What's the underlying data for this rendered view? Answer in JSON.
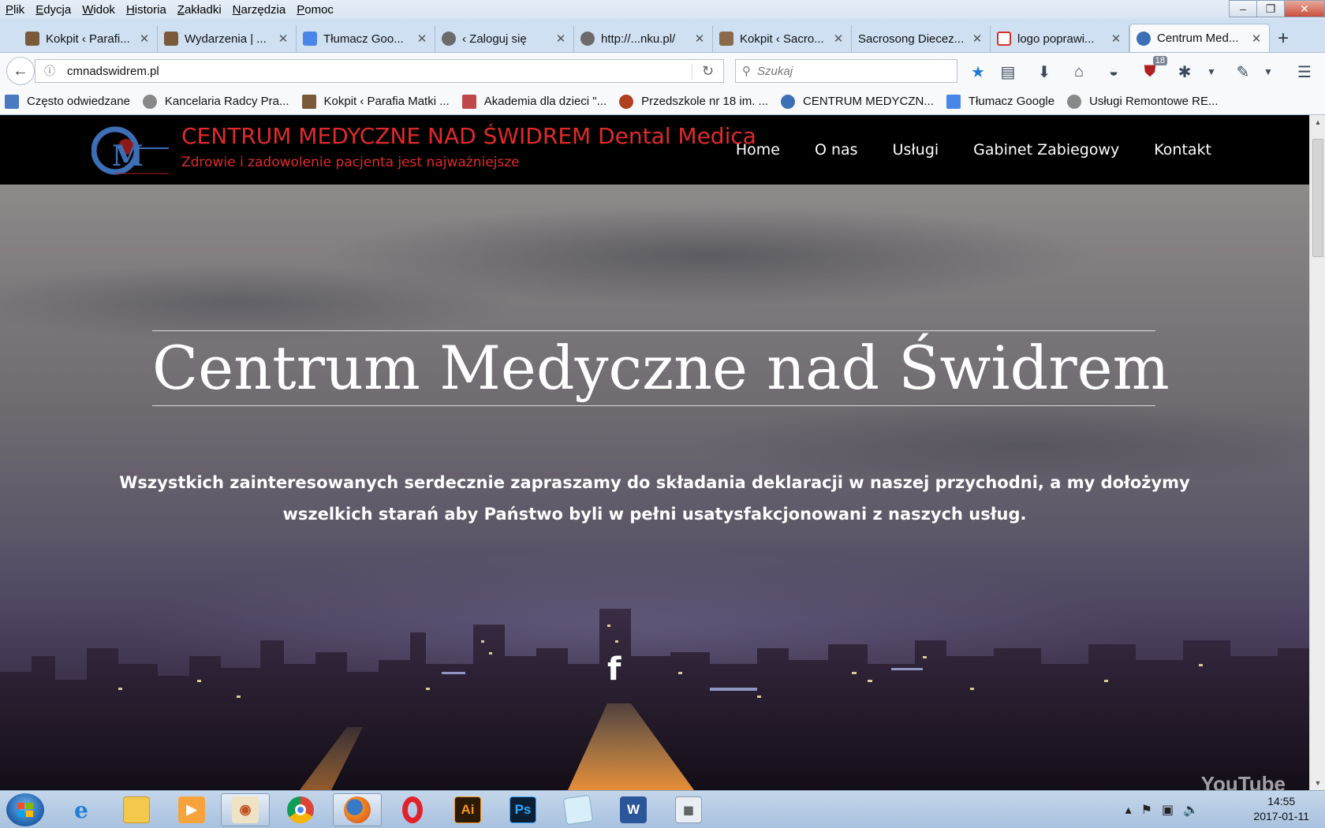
{
  "menu": [
    "Plik",
    "Edycja",
    "Widok",
    "Historia",
    "Zakładki",
    "Narzędzia",
    "Pomoc"
  ],
  "tabs": [
    {
      "label": "Kokpit ‹ Parafi...",
      "fav": "#7a5a3a"
    },
    {
      "label": "Wydarzenia | ...",
      "fav": "#7a5a3a"
    },
    {
      "label": "Tłumacz Goo...",
      "fav": "#4a86e8"
    },
    {
      "label": "‹ Zaloguj się",
      "fav": "#6b6b6b"
    },
    {
      "label": "http://...nku.pl/",
      "fav": "#6b6b6b"
    },
    {
      "label": "Kokpit ‹ Sacro...",
      "fav": "#8a6a4a"
    },
    {
      "label": "Sacrosong Diecez...",
      "fav": ""
    },
    {
      "label": "logo poprawi...",
      "fav": "#d93025"
    },
    {
      "label": "Centrum Med...",
      "fav": "#3d6fb6",
      "active": true
    }
  ],
  "address": {
    "url": "cmnadswidrem.pl"
  },
  "search": {
    "placeholder": "Szukaj"
  },
  "toolbar": {
    "badge": "18"
  },
  "bookmarks": [
    {
      "label": "Często odwiedzane",
      "fav": "#4a7bc0"
    },
    {
      "label": "Kancelaria Radcy Pra...",
      "fav": "#888"
    },
    {
      "label": "Kokpit ‹ Parafia Matki ...",
      "fav": "#7a5a3a"
    },
    {
      "label": "Akademia dla dzieci \"...",
      "fav": "#c04848"
    },
    {
      "label": "Przedszkole nr 18 im. ...",
      "fav": "#b04020"
    },
    {
      "label": "CENTRUM MEDYCZN...",
      "fav": "#3d6fb6"
    },
    {
      "label": "Tłumacz Google",
      "fav": "#4a86e8"
    },
    {
      "label": "Usługi Remontowe RE...",
      "fav": "#888"
    }
  ],
  "site": {
    "title": "CENTRUM MEDYCZNE NAD ŚWIDREM Dental Medica",
    "tagline": "Zdrowie i zadowolenie pacjenta jest najważniejsze",
    "logo_text": "CM",
    "nav": [
      "Home",
      "O nas",
      "Usługi",
      "Gabinet Zabiegowy",
      "Kontakt"
    ],
    "hero_title": "Centrum Medyczne nad Świdrem",
    "hero_text": "Wszystkich zainteresowanych serdecznie zapraszamy do składania deklaracji w naszej przychodni, a my dołożymy wszelkich starań aby Państwo byli w pełni usatysfakcjonowani z naszych usług.",
    "facebook_glyph": "f",
    "video_watermark": "YouTube"
  },
  "taskbar": {
    "apps": [
      "internet-explorer",
      "file-explorer",
      "media-player",
      "image-viewer",
      "chrome",
      "firefox",
      "opera",
      "illustrator",
      "photoshop",
      "notepad",
      "word",
      "calculator"
    ],
    "ai_label": "Ai",
    "ps_label": "Ps",
    "w_label": "W",
    "time": "14:55",
    "date": "2017-01-11"
  }
}
